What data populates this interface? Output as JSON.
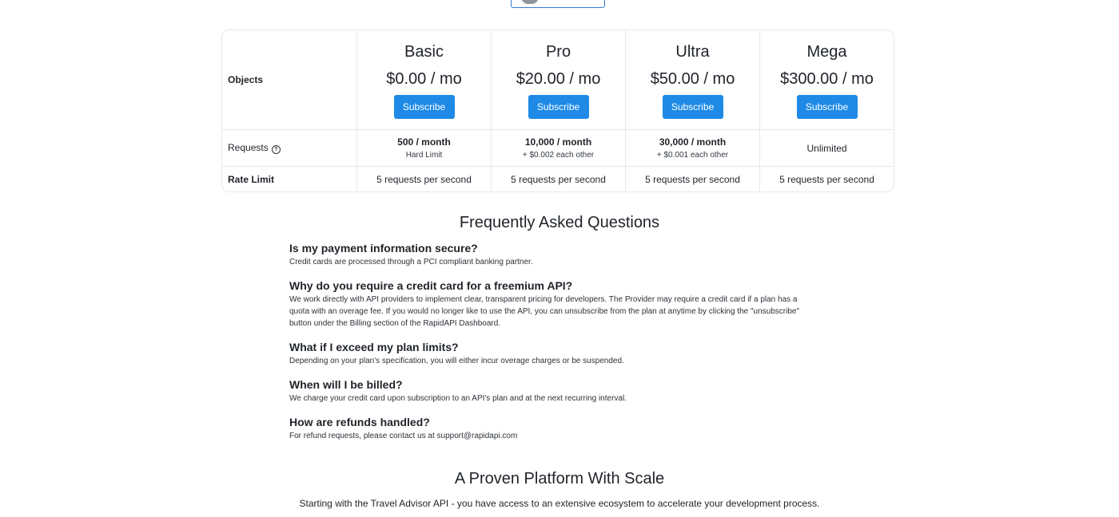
{
  "colors": {
    "accent": "#1e8ae6",
    "border": "#e6e8eb",
    "text": "#1f2329"
  },
  "pricing": {
    "objects_label": "Objects",
    "requests_label": "Requests",
    "rate_limit_label": "Rate Limit",
    "subscribe_label": "Subscribe",
    "plans": [
      {
        "name": "Basic",
        "price": "$0.00 / mo",
        "requests_main": "500 / month",
        "requests_sub": "Hard Limit",
        "rate_limit": "5 requests per second"
      },
      {
        "name": "Pro",
        "price": "$20.00 / mo",
        "requests_main": "10,000 / month",
        "requests_sub": "+ $0.002 each other",
        "rate_limit": "5 requests per second"
      },
      {
        "name": "Ultra",
        "price": "$50.00 / mo",
        "requests_main": "30,000 / month",
        "requests_sub": "+ $0.001 each other",
        "rate_limit": "5 requests per second"
      },
      {
        "name": "Mega",
        "price": "$300.00 / mo",
        "requests_plain": "Unlimited",
        "rate_limit": "5 requests per second"
      }
    ]
  },
  "faq": {
    "title": "Frequently Asked Questions",
    "items": [
      {
        "q": "Is my payment information secure?",
        "a": "Credit cards are processed through a PCI compliant banking partner."
      },
      {
        "q": "Why do you require a credit card for a freemium API?",
        "a": "We work directly with API providers to implement clear, transparent pricing for developers. The Provider may require a credit card if a plan has a quota with an overage fee. If you would no longer like to use the API, you can unsubscribe from the plan at anytime by clicking the \"unsubscribe\" button under the Billing section of the RapidAPI Dashboard."
      },
      {
        "q": "What if I exceed my plan limits?",
        "a": "Depending on your plan's specification, you will either incur overage charges or be suspended."
      },
      {
        "q": "When will I be billed?",
        "a": "We charge your credit card upon subscription to an API's plan and at the next recurring interval."
      },
      {
        "q": "How are refunds handled?",
        "a": "For refund requests, please contact us at support@rapidapi.com"
      }
    ]
  },
  "platform": {
    "title": "A Proven Platform With Scale",
    "text": "Starting with the Travel Advisor API - you have access to an extensive ecosystem to accelerate your development process."
  }
}
